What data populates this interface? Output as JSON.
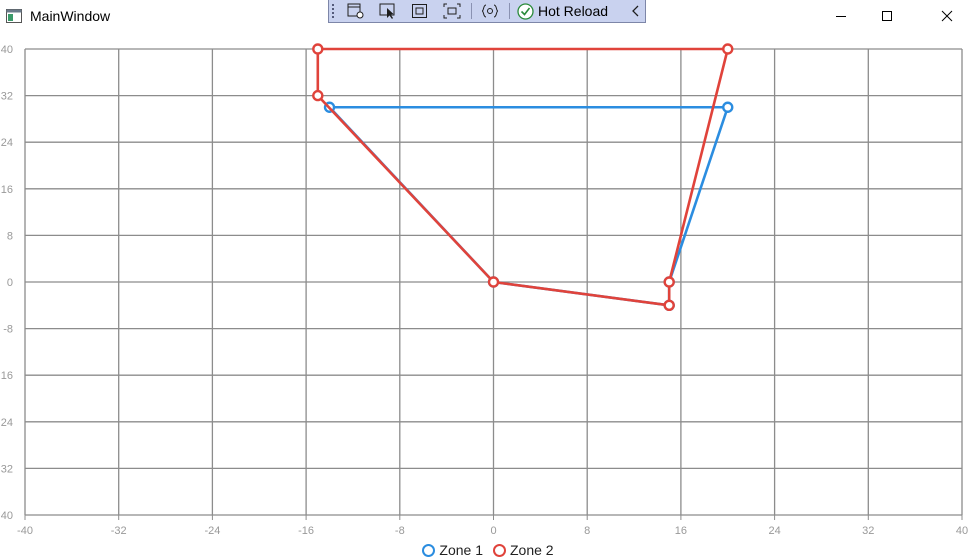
{
  "window": {
    "title": "MainWindow",
    "icon": "app-window-icon",
    "controls": [
      "minimize-icon",
      "maximize-icon",
      "close-icon"
    ]
  },
  "devtoolbar": {
    "buttons": [
      "live-visual-tree-icon",
      "select-element-icon",
      "display-adorners-icon",
      "track-focus-icon",
      "binding-failures-icon"
    ],
    "hot_reload_label": "Hot Reload",
    "collapse_icon": "chevron-left-icon"
  },
  "chart_data": {
    "type": "line",
    "xlim": [
      -40,
      40
    ],
    "ylim": [
      -40,
      40
    ],
    "xticks": [
      "-40",
      "-32",
      "-24",
      "-16",
      "-8",
      "0",
      "8",
      "16",
      "24",
      "32",
      "40"
    ],
    "yticks": [
      "40",
      "32",
      "24",
      "16",
      "8",
      "0",
      "-8",
      "16",
      "24",
      "32",
      "40"
    ],
    "grid": true,
    "legend_position": "bottom-center",
    "series": [
      {
        "name": "Zone 1",
        "color": "#2b8de0",
        "points": [
          [
            20,
            30
          ],
          [
            -14,
            30
          ],
          [
            0,
            0
          ],
          [
            15,
            -4
          ],
          [
            15,
            0
          ],
          [
            20,
            30
          ]
        ]
      },
      {
        "name": "Zone 2",
        "color": "#e0433b",
        "points": [
          [
            -15,
            40
          ],
          [
            20,
            40
          ],
          [
            15,
            0
          ],
          [
            15,
            -4
          ],
          [
            0,
            0
          ],
          [
            -15,
            32
          ],
          [
            -15,
            40
          ]
        ]
      }
    ]
  }
}
